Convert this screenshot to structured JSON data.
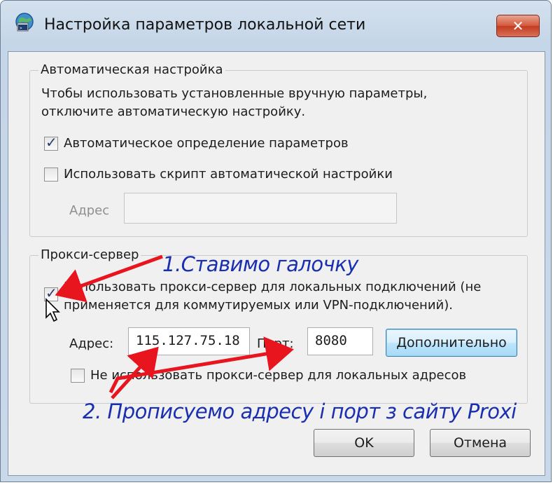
{
  "window": {
    "title": "Настройка параметров локальной сети",
    "close_label": "✕"
  },
  "auto_config": {
    "legend": "Автоматическая настройка",
    "description_line1": "Чтобы использовать установленные вручную параметры,",
    "description_line2": "отключите автоматическую настройку.",
    "auto_detect_label": "Автоматическое определение параметров",
    "auto_detect_checked": true,
    "use_script_label": "Использовать скрипт автоматической настройки",
    "use_script_checked": false,
    "address_label": "Адрес",
    "address_value": ""
  },
  "proxy": {
    "legend": "Прокси-сервер",
    "use_proxy_line1": "Использовать прокси-сервер для локальных подключений (не",
    "use_proxy_line2": "применяется для коммутируемых или VPN-подключений).",
    "use_proxy_checked": true,
    "address_label": "Адрес:",
    "address_value": "115.127.75.18",
    "port_label": "Порт:",
    "port_value": "8080",
    "advanced_button": "Дополнительно",
    "bypass_local_label": "Не использовать прокси-сервер для локальных адресов",
    "bypass_local_checked": false
  },
  "buttons": {
    "ok": "OK",
    "cancel": "Отмена"
  },
  "annotations": {
    "step1": "1.Ставимо галочку",
    "step2": "2. Прописуемо адресу і порт з сайту Proxi",
    "color": "#1a2fb0",
    "arrow_color": "#e8141e"
  },
  "colors": {
    "title_bar": "#c5d6e8",
    "close_button": "#c23c20",
    "dialog_bg": "#f0f0f0"
  }
}
